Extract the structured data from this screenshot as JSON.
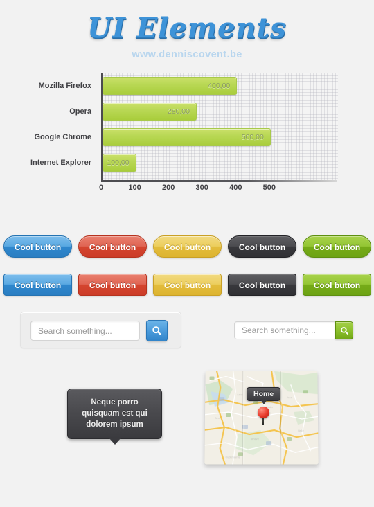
{
  "header": {
    "title": "UI Elements",
    "subtitle": "www.denniscovent.be"
  },
  "chart_data": {
    "type": "bar",
    "orientation": "horizontal",
    "title": "",
    "xlabel": "",
    "ylabel": "",
    "categories": [
      "Mozilla Firefox",
      "Opera",
      "Google Chrome",
      "Internet Explorer"
    ],
    "values": [
      400,
      280,
      500,
      100
    ],
    "value_labels": [
      "400,00",
      "280,00",
      "500,00",
      "100,00"
    ],
    "xticks": [
      0,
      100,
      200,
      300,
      400,
      500
    ],
    "xtick_labels": [
      "0",
      "100",
      "200",
      "300",
      "400",
      "500"
    ],
    "xlim": [
      0,
      700
    ],
    "grid": true,
    "legend": false,
    "bar_color": "#b5d554"
  },
  "buttons": {
    "rounded_label": "Cool button",
    "square_label": "Cool button",
    "items": [
      {
        "label": "Cool button",
        "color_name": "blue",
        "color": "#3f92d2"
      },
      {
        "label": "Cool button",
        "color_name": "red",
        "color": "#d9503a"
      },
      {
        "label": "Cool button",
        "color_name": "yellow",
        "color": "#e6c449"
      },
      {
        "label": "Cool button",
        "color_name": "dark",
        "color": "#434347"
      },
      {
        "label": "Cool button",
        "color_name": "green",
        "color": "#86ba26"
      }
    ]
  },
  "search_boxed": {
    "placeholder": "Search something...",
    "value": "",
    "button_icon": "search-icon",
    "button_color": "#4c9cdc"
  },
  "search_plain": {
    "placeholder": "Search something...",
    "value": "",
    "button_icon": "search-icon",
    "button_color": "#8cc02d"
  },
  "tooltip": {
    "text": "Neque porro quisquam est qui dolorem ipsum"
  },
  "map": {
    "pin_label": "Home",
    "pin_color": "#e8392a"
  }
}
